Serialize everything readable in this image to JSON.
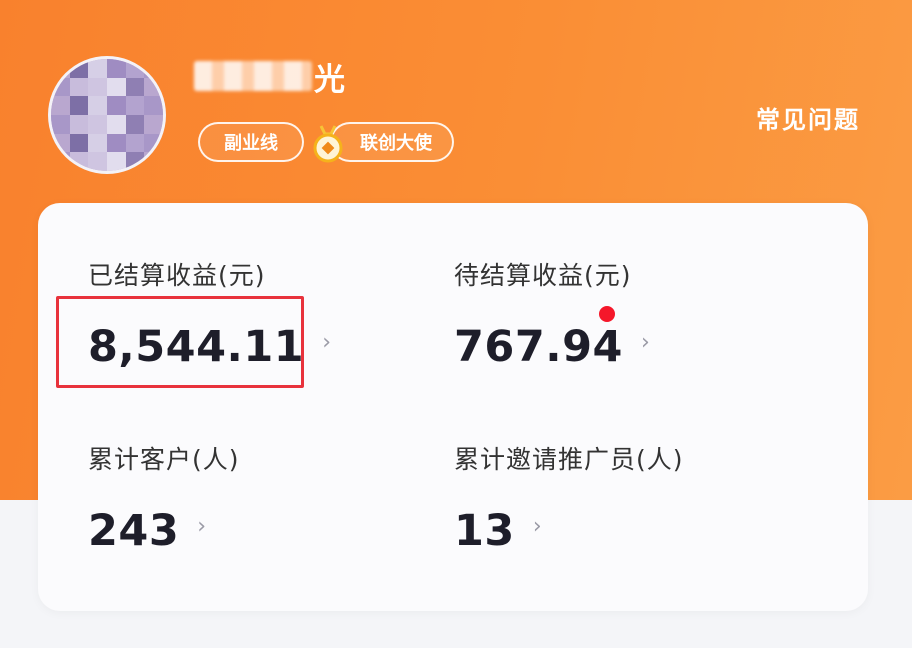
{
  "profile": {
    "username_visible_tail": "光",
    "avatar_blurred": true
  },
  "tags": {
    "tag_1": "副业线",
    "tag_2": "联创大使"
  },
  "header": {
    "faq_label": "常见问题"
  },
  "stats": {
    "settled_income": {
      "label": "已结算收益(元)",
      "value": "8,544.11"
    },
    "pending_income": {
      "label": "待结算收益(元)",
      "value": "767.94"
    },
    "total_customers": {
      "label": "累计客户(人)",
      "value": "243"
    },
    "total_promoters": {
      "label": "累计邀请推广员(人)",
      "value": "13"
    },
    "chevron": "›"
  },
  "colors": {
    "header_gradient_start": "#f9812d",
    "header_gradient_end": "#fb9c44",
    "highlight_red": "#e8323c",
    "notification_dot": "#f5172a"
  },
  "icons": {
    "medal": "medal-icon",
    "chevron": "chevron-right-icon"
  }
}
